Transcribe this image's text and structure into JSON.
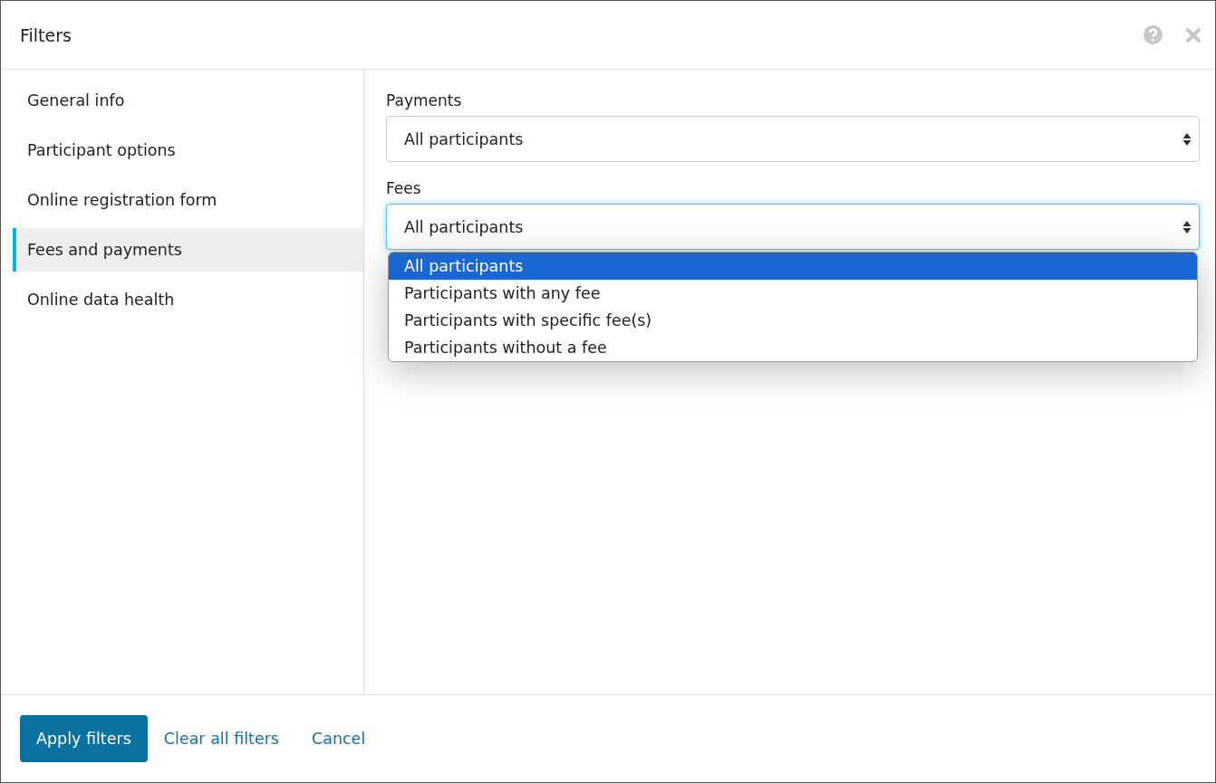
{
  "dialog": {
    "title": "Filters"
  },
  "sidebar": {
    "items": [
      {
        "label": "General info",
        "selected": false
      },
      {
        "label": "Participant options",
        "selected": false
      },
      {
        "label": "Online registration form",
        "selected": false
      },
      {
        "label": "Fees and payments",
        "selected": true
      },
      {
        "label": "Online data health",
        "selected": false
      }
    ]
  },
  "fields": [
    {
      "label": "Payments",
      "value": "All participants",
      "focused": false
    },
    {
      "label": "Fees",
      "value": "All participants",
      "focused": true,
      "expanded": true,
      "options": [
        {
          "label": "All participants",
          "selected": true
        },
        {
          "label": "Participants with any fee",
          "selected": false
        },
        {
          "label": "Participants with specific fee(s)",
          "selected": false
        },
        {
          "label": "Participants without a fee",
          "selected": false
        }
      ]
    }
  ],
  "footer": {
    "primary": "Apply filters",
    "links": [
      "Clear all filters",
      "Cancel"
    ]
  }
}
